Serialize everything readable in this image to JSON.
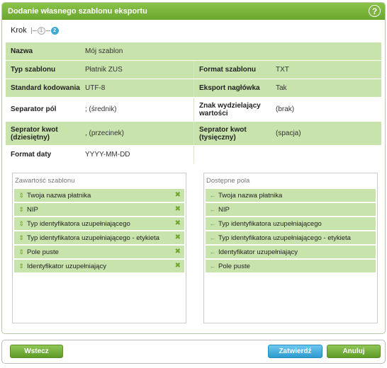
{
  "dialog": {
    "title": "Dodanie własnego szablonu eksportu",
    "help_icon": "?",
    "steps": {
      "label": "Krok",
      "step1": "1",
      "step2": "2"
    }
  },
  "form": {
    "nazwa": {
      "label": "Nazwa",
      "value": "Mój szablon"
    },
    "typ_szablonu": {
      "label": "Typ szablonu",
      "value": "Płatnik ZUS"
    },
    "format_szablonu": {
      "label": "Format szablonu",
      "value": "TXT"
    },
    "standard_kodowania": {
      "label": "Standard kodowania",
      "value": "UTF-8"
    },
    "eksport_naglowka": {
      "label": "Eksport nagłówka",
      "value": "Tak"
    },
    "separator_pol": {
      "label": "Separator pól",
      "value": "; (średnik)"
    },
    "znak_wydzielajacy": {
      "label": "Znak wydzielający wartości",
      "value": "(brak)"
    },
    "separator_kwot_dz": {
      "label": "Seprator kwot (dziesiętny)",
      "value": ", (przecinek)"
    },
    "separator_kwot_tys": {
      "label": "Seprator kwot (tysięczny)",
      "value": "(spacja)"
    },
    "format_daty": {
      "label": "Format daty",
      "value": "YYYY-MM-DD"
    }
  },
  "zawartosc": {
    "title": "Zawartość szablonu",
    "items": [
      "Twoja nazwa płatnika",
      "NIP",
      "Typ identyfikatora uzupełniającego",
      "Typ identyfikatora uzupełniającego - etykieta",
      "Pole puste",
      "Identyfikator uzupełniający"
    ]
  },
  "dostepne": {
    "title": "Dostępne pola",
    "items": [
      "Twoja nazwa płatnika",
      "NIP",
      "Typ identyfikatora uzupełniającego",
      "Typ identyfikatora uzupełniającego - etykieta",
      "Identyfikator uzupełniający",
      "Pole puste"
    ]
  },
  "buttons": {
    "back": "Wstecz",
    "confirm": "Zatwierdź",
    "cancel": "Anuluj"
  },
  "colors": {
    "accent": "#6aa62e",
    "row_green": "#c9e3ad",
    "blue": "#2c9ad0"
  }
}
